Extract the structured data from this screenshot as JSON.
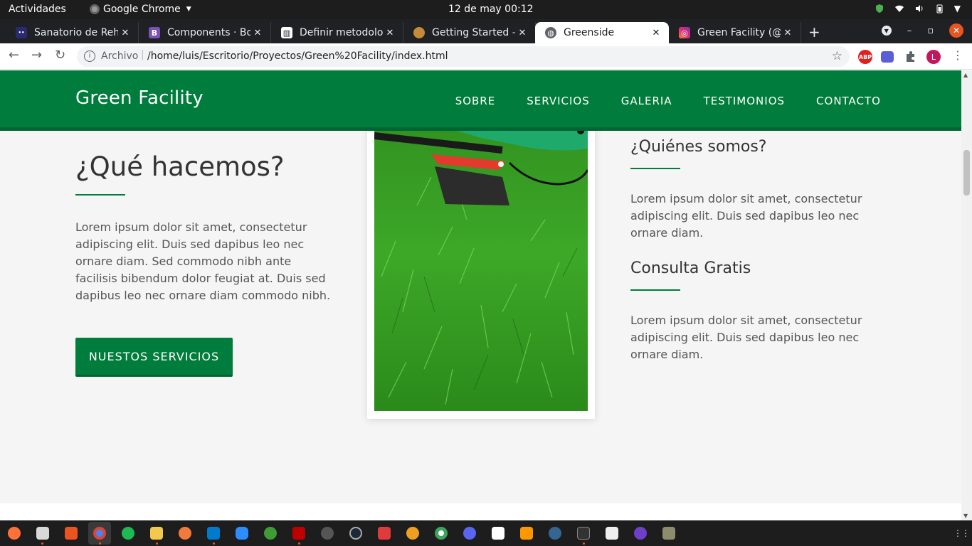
{
  "system": {
    "activities": "Actividades",
    "app_name": "Google Chrome",
    "clock": "12 de may  00:12"
  },
  "browser": {
    "tabs": [
      {
        "title": "Sanatorio de Rehabilitación",
        "favicon": "sanatorio-favicon",
        "active": false
      },
      {
        "title": "Components · Bootstrap",
        "favicon": "bootstrap-favicon",
        "active": false
      },
      {
        "title": "Definir metodología",
        "favicon": "trello-favicon",
        "active": false
      },
      {
        "title": "Getting Started – ",
        "favicon": "getting-started-favicon",
        "active": false
      },
      {
        "title": "Greenside",
        "favicon": "globe-favicon",
        "active": true
      },
      {
        "title": "Green Facility (@g",
        "favicon": "instagram-favicon",
        "active": false
      }
    ],
    "address_scheme": "Archivo",
    "address_url": "/home/luis/Escritorio/Proyectos/Green%20Facility/index.html",
    "profile_initial": "L",
    "abp_label": "ABP"
  },
  "site": {
    "brand": "Green Facility",
    "nav": [
      "SOBRE",
      "SERVICIOS",
      "GALERIA",
      "TESTIMONIOS",
      "CONTACTO"
    ],
    "section_title": "¿Qué hacemos?",
    "section_text": "Lorem ipsum dolor sit amet, consectetur adipiscing elit. Duis sed dapibus leo nec ornare diam. Sed commodo nibh ante facilisis bibendum dolor feugiat at. Duis sed dapibus leo nec ornare diam commodo nibh.",
    "cta_label": "NUESTOS SERVICIOS",
    "about_title": "¿Quiénes somos?",
    "about_text": "Lorem ipsum dolor sit amet, consectetur adipiscing elit. Duis sed dapibus leo nec ornare diam.",
    "consult_title": "Consulta Gratis",
    "consult_text": "Lorem ipsum dolor sit amet, consectetur adipiscing elit. Duis sed dapibus leo nec ornare diam."
  },
  "colors": {
    "brand_green": "#007d3c",
    "topbar": "#1d1d1d",
    "tabstrip": "#202124"
  }
}
